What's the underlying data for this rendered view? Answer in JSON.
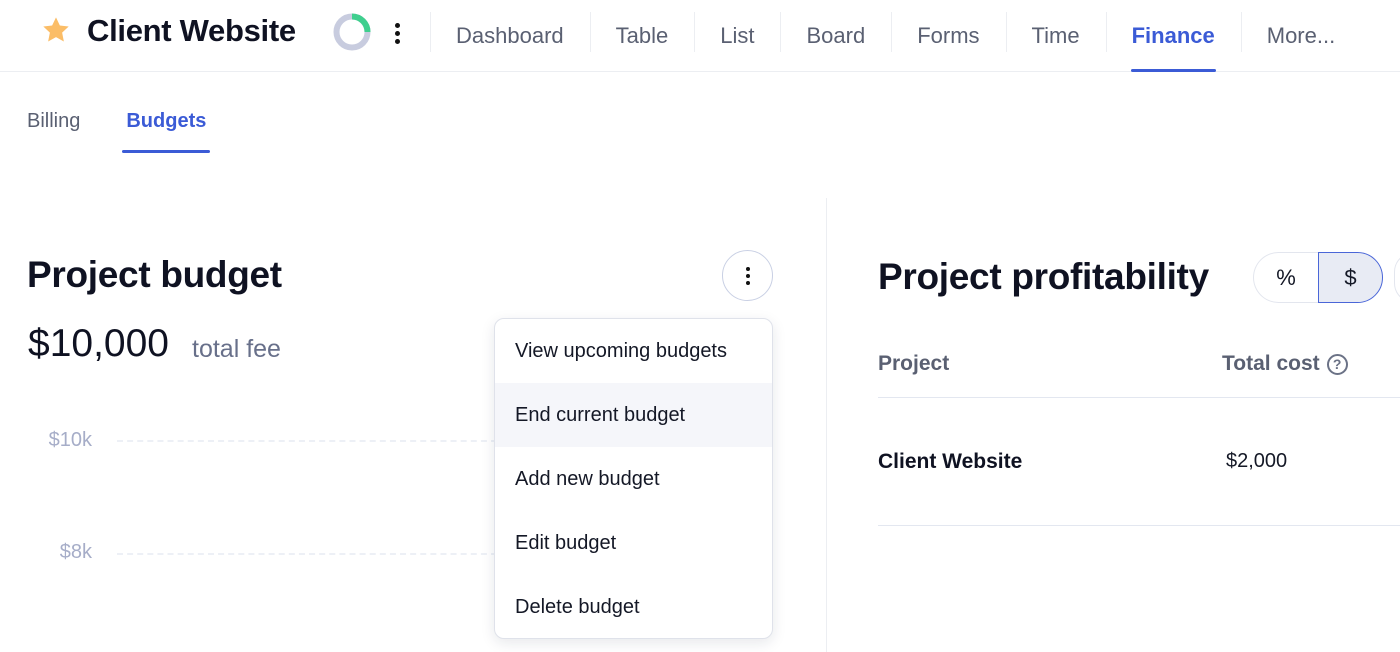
{
  "header": {
    "project_title": "Client Website",
    "favorite": true,
    "progress_fraction": 0.25,
    "colors": {
      "star": "#fbbd67",
      "ring_progress": "#3fcf8e",
      "ring_track": "#c8ccdf",
      "accent": "#3b5bd6"
    },
    "nav": [
      {
        "label": "Dashboard",
        "active": false
      },
      {
        "label": "Table",
        "active": false
      },
      {
        "label": "List",
        "active": false
      },
      {
        "label": "Board",
        "active": false
      },
      {
        "label": "Forms",
        "active": false
      },
      {
        "label": "Time",
        "active": false
      },
      {
        "label": "Finance",
        "active": true
      },
      {
        "label": "More...",
        "active": false
      }
    ]
  },
  "subtabs": [
    {
      "label": "Billing",
      "active": false
    },
    {
      "label": "Budgets",
      "active": true
    }
  ],
  "project_budget": {
    "title": "Project budget",
    "amount": "$10,000",
    "amount_caption": "total fee",
    "chart_y_ticks": [
      "$10k",
      "$8k"
    ]
  },
  "budget_menu": {
    "items": [
      {
        "label": "View upcoming budgets",
        "hover": false
      },
      {
        "label": "End current budget",
        "hover": true
      },
      {
        "label": "Add new budget",
        "hover": false
      },
      {
        "label": "Edit budget",
        "hover": false
      },
      {
        "label": "Delete budget",
        "hover": false
      }
    ]
  },
  "project_profitability": {
    "title": "Project profitability",
    "toggle": {
      "options": [
        "%",
        "$"
      ],
      "selected": "$"
    },
    "columns": [
      "Project",
      "Total cost"
    ],
    "rows": [
      {
        "project": "Client Website",
        "total_cost": "$2,000"
      }
    ]
  }
}
